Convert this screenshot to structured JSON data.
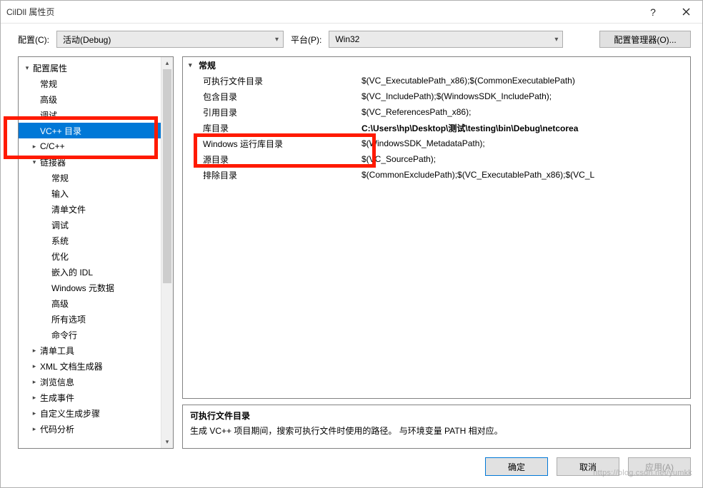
{
  "titlebar": {
    "title": "CilDll 属性页"
  },
  "toprow": {
    "config_label": "配置(C):",
    "config_value": "活动(Debug)",
    "platform_label": "平台(P):",
    "platform_value": "Win32",
    "configmgr_label": "配置管理器(O)..."
  },
  "tree": {
    "root": "配置属性",
    "items_lvl1": [
      "常规",
      "高级",
      "调试",
      "VC++ 目录",
      "C/C++"
    ],
    "linker": "链接器",
    "linker_children": [
      "常规",
      "输入",
      "清单文件",
      "调试",
      "系统",
      "优化",
      "嵌入的 IDL",
      "Windows 元数据",
      "高级",
      "所有选项",
      "命令行"
    ],
    "tail": [
      "清单工具",
      "XML 文档生成器",
      "浏览信息",
      "生成事件",
      "自定义生成步骤",
      "代码分析"
    ]
  },
  "grid": {
    "section": "常规",
    "rows": [
      {
        "k": "可执行文件目录",
        "v": "$(VC_ExecutablePath_x86);$(CommonExecutablePath)"
      },
      {
        "k": "包含目录",
        "v": "$(VC_IncludePath);$(WindowsSDK_IncludePath);"
      },
      {
        "k": "引用目录",
        "v": "$(VC_ReferencesPath_x86);"
      },
      {
        "k": "库目录",
        "v": "C:\\Users\\hp\\Desktop\\测试\\testing\\bin\\Debug\\netcorea",
        "bold": true
      },
      {
        "k": "Windows 运行库目录",
        "v": "$(WindowsSDK_MetadataPath);"
      },
      {
        "k": "源目录",
        "v": "$(VC_SourcePath);"
      },
      {
        "k": "排除目录",
        "v": "$(CommonExcludePath);$(VC_ExecutablePath_x86);$(VC_L"
      }
    ]
  },
  "desc": {
    "title": "可执行文件目录",
    "text": "生成 VC++ 项目期间，搜索可执行文件时使用的路径。  与环境变量 PATH 相对应。"
  },
  "buttons": {
    "ok": "确定",
    "cancel": "取消",
    "apply": "应用(A)"
  },
  "watermark": "https://blog.csdn.net/yumkk"
}
